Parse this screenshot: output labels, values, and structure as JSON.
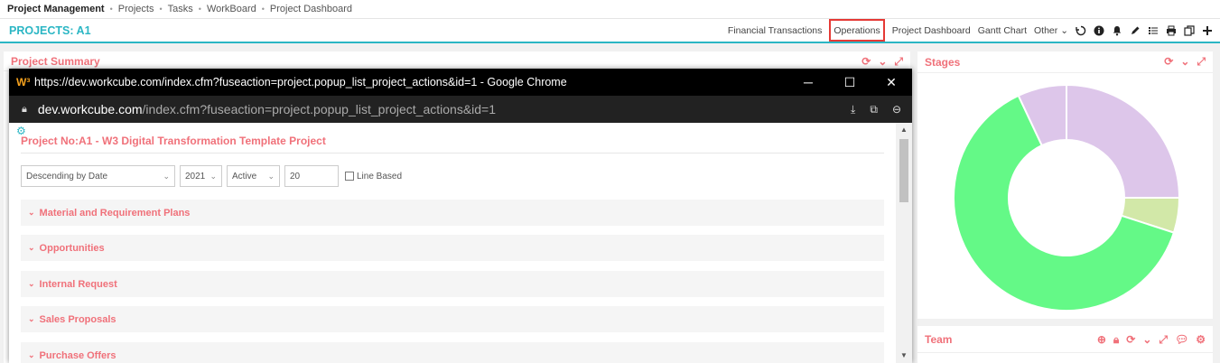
{
  "topnav": {
    "module": "Project Management",
    "items": [
      "Projects",
      "Tasks",
      "WorkBoard",
      "Project Dashboard"
    ]
  },
  "project": {
    "title": "PROJECTS: A1",
    "menu": {
      "financial": "Financial Transactions",
      "operations": "Operations",
      "dashboard": "Project Dashboard",
      "gantt": "Gantt Chart",
      "other": "Other"
    }
  },
  "panels": {
    "summary_title": "Project Summary",
    "stages_title": "Stages",
    "team_title": "Team"
  },
  "popup": {
    "window_title": "https://dev.workcube.com/index.cfm?fuseaction=project.popup_list_project_actions&id=1 - Google Chrome",
    "url_host": "dev.workcube.com",
    "url_path": "/index.cfm?fuseaction=project.popup_list_project_actions&id=1",
    "project_title": "Project No:A1 - W3 Digital Transformation Template Project",
    "filters": {
      "sort": "Descending by Date",
      "year": "2021",
      "status": "Active",
      "count": "20",
      "line_based": "Line Based"
    },
    "sections": [
      "Material and Requirement Plans",
      "Opportunities",
      "Internal Request",
      "Sales Proposals",
      "Purchase Offers"
    ]
  },
  "stages_chart": {
    "type": "donut",
    "colors": [
      "#ddc6ea",
      "#d2e8a8",
      "#64f987",
      "#ddc6ea"
    ],
    "values": [
      25,
      5,
      63,
      7
    ]
  }
}
